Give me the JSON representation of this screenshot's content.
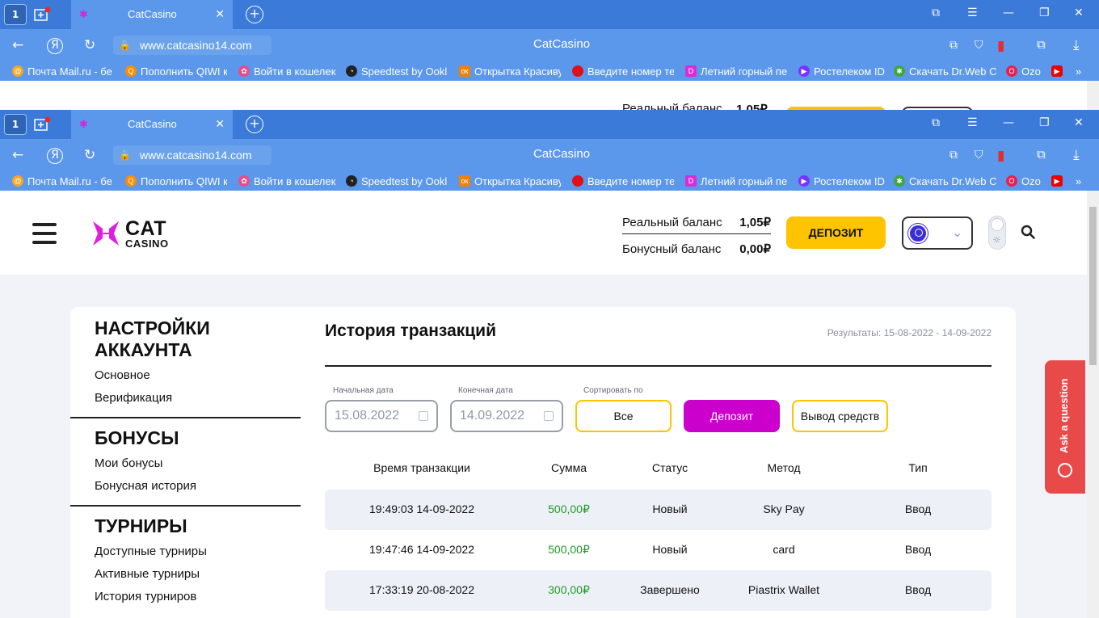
{
  "browser": {
    "tab_count": "1",
    "tab_title": "CatCasino",
    "url": "www.catcasino14.com",
    "page_title": "CatCasino",
    "badge": "1",
    "bookmarks": [
      {
        "label": "Почта Mail.ru - бе",
        "color": "#f5a623"
      },
      {
        "label": "Пополнить QIWI к",
        "color": "#ff8c00"
      },
      {
        "label": "Войти в кошелек",
        "color": "#e84c8c"
      },
      {
        "label": "Speedtest by Ookl",
        "color": "#222222"
      },
      {
        "label": "Открытка Красиву",
        "color": "#ee8208"
      },
      {
        "label": "Введите номер те",
        "color": "#e0101a"
      },
      {
        "label": "Летний горный пе",
        "color": "#d62fd6"
      },
      {
        "label": "Ростелеком ID",
        "color": "#7a33ff"
      },
      {
        "label": "Скачать Dr.Web C",
        "color": "#3ea83e"
      },
      {
        "label": "Ozo",
        "color": "#e9204f"
      }
    ]
  },
  "ghost_header": {
    "real_balance_label": "Реальный баланс",
    "real_balance_value": "1,05₽"
  },
  "header": {
    "logo_cat": "CAT",
    "logo_casino": "CASINO",
    "real_balance_label": "Реальный баланс",
    "real_balance_value": "1,05₽",
    "bonus_balance_label": "Бонусный баланс",
    "bonus_balance_value": "0,00₽",
    "deposit_button": "ДЕПОЗИТ"
  },
  "sidebar": {
    "sections": [
      {
        "title_line1": "НАСТРОЙКИ",
        "title_line2": "АККАУНТА",
        "links": [
          "Основное",
          "Верификация"
        ]
      },
      {
        "title_line1": "БОНУСЫ",
        "links": [
          "Мои бонусы",
          "Бонусная история"
        ]
      },
      {
        "title_line1": "ТУРНИРЫ",
        "links": [
          "Доступные турниры",
          "Активные турниры",
          "История турниров"
        ]
      }
    ]
  },
  "main": {
    "title": "История транзакций",
    "results": "Результаты: 15-08-2022 - 14-09-2022",
    "start_label": "Начальная дата",
    "start_value": "15.08.2022",
    "end_label": "Конечная дата",
    "end_value": "14.09.2022",
    "sort_label": "Сортировать по",
    "filters": [
      "Все",
      "Депозит",
      "Вывод средств"
    ],
    "active_filter": "Депозит",
    "columns": [
      "Время транзакции",
      "Сумма",
      "Статус",
      "Метод",
      "Тип"
    ],
    "rows": [
      {
        "time": "19:49:03 14-09-2022",
        "amount": "500,00₽",
        "status": "Новый",
        "method": "Sky Pay",
        "type": "Ввод"
      },
      {
        "time": "19:47:46 14-09-2022",
        "amount": "500,00₽",
        "status": "Новый",
        "method": "card",
        "type": "Ввод"
      },
      {
        "time": "17:33:19 20-08-2022",
        "amount": "300,00₽",
        "status": "Завершено",
        "method": "Piastrix Wallet",
        "type": "Ввод"
      }
    ]
  },
  "widget": {
    "ask": "Ask a question"
  },
  "colors": {
    "accent_yellow": "#ffc400",
    "accent_magenta": "#cc00cc",
    "amount_green": "#1e9b2a",
    "browser_blue": "#5b97ea"
  }
}
